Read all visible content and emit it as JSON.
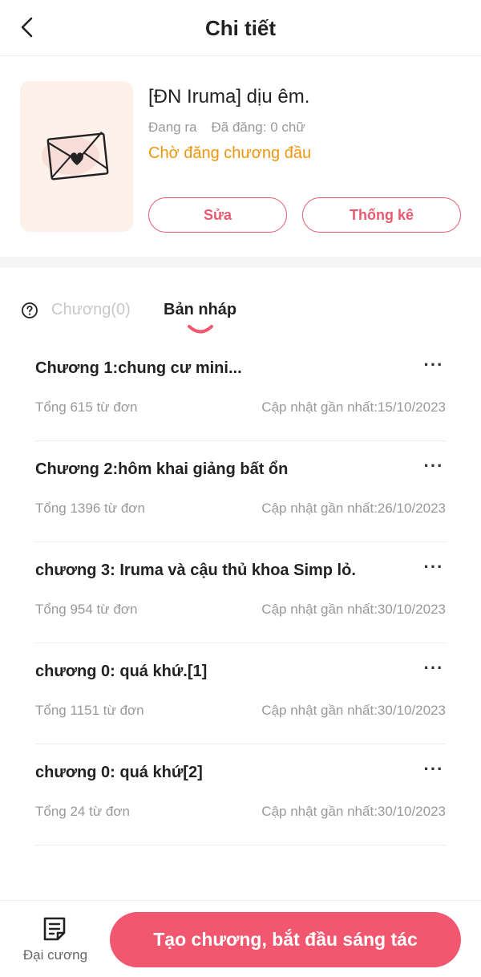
{
  "header": {
    "title": "Chi tiết"
  },
  "book": {
    "title": "[ĐN Iruma] dịu êm.",
    "status_label": "Đang ra",
    "words_label": "Đã đăng: 0 chữ",
    "publish_status": "Chờ đăng chương đầu",
    "edit_label": "Sửa",
    "stats_label": "Thống kê"
  },
  "tabs": {
    "chapters": "Chương(0)",
    "drafts": "Bản nháp",
    "active": "drafts"
  },
  "drafts": [
    {
      "title": "Chương 1:chung cư mini...",
      "words": "Tổng 615 từ đơn",
      "updated": "Cập nhật gần nhất:15/10/2023"
    },
    {
      "title": "Chương 2:hôm khai giảng bất ổn",
      "words": "Tổng 1396 từ đơn",
      "updated": "Cập nhật gần nhất:26/10/2023"
    },
    {
      "title": "chương 3: Iruma và cậu thủ khoa Simp lỏ.",
      "words": "Tổng 954 từ đơn",
      "updated": "Cập nhật gần nhất:30/10/2023"
    },
    {
      "title": "chương 0: quá khứ.[1]",
      "words": "Tổng 1151 từ đơn",
      "updated": "Cập nhật gần nhất:30/10/2023"
    },
    {
      "title": "chương 0: quá khứ[2]",
      "words": "Tổng 24 từ đơn",
      "updated": "Cập nhật gần nhất:30/10/2023"
    }
  ],
  "more_label": "···",
  "bottom": {
    "outline_label": "Đại cương",
    "create_label": "Tạo chương, bắt đầu sáng tác"
  },
  "colors": {
    "accent": "#f1586f",
    "status_orange": "#f0960e",
    "muted": "#999999",
    "cover_bg": "#fdf1ea"
  },
  "icons": {
    "back": "chevron-left-icon",
    "cover": "envelope-heart-icon",
    "help": "question-circle-icon",
    "more": "more-dots-icon",
    "outline": "document-lines-icon"
  }
}
